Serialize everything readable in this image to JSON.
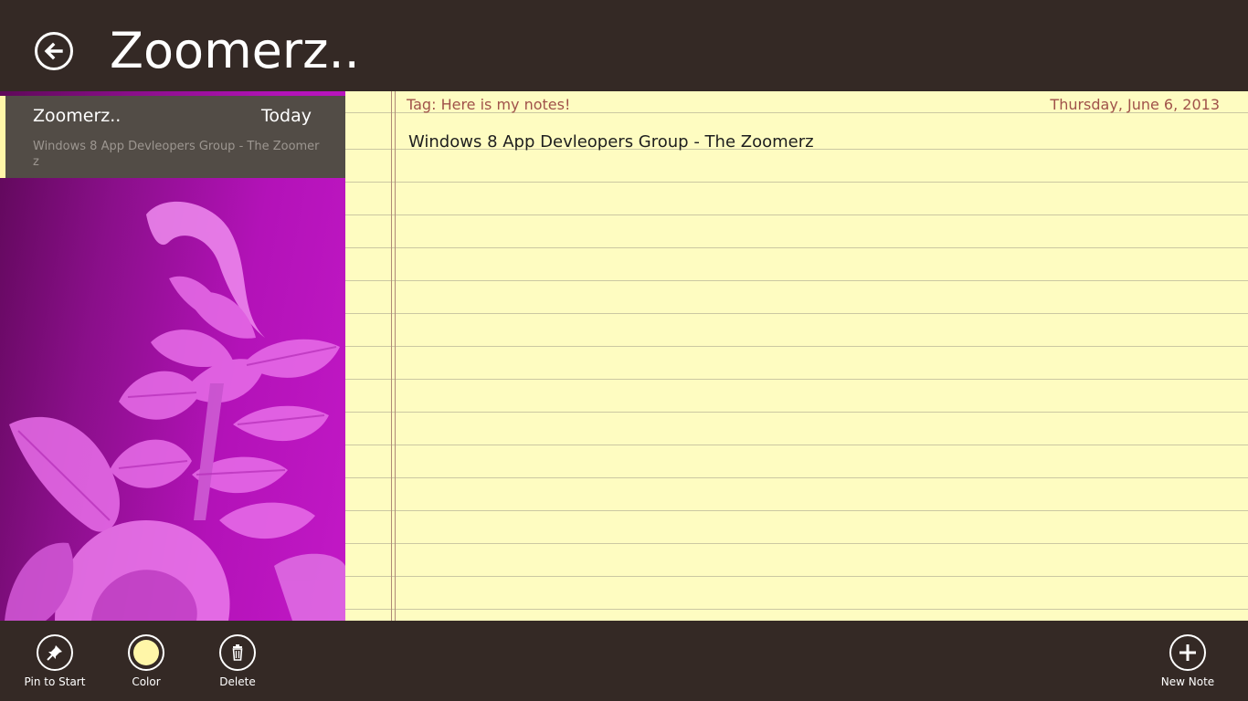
{
  "header": {
    "title": "Zoomerz.."
  },
  "notes_list": {
    "items": [
      {
        "title": "Zoomerz..",
        "date": "Today",
        "preview": "Windows 8 App Devleopers Group - The Zoomerz"
      }
    ]
  },
  "note": {
    "tag": "Tag: Here is my notes!",
    "date": "Thursday, June 6, 2013",
    "body": "Windows 8 App Devleopers Group - The Zoomerz"
  },
  "appbar": {
    "pin_label": "Pin to Start",
    "color_label": "Color",
    "delete_label": "Delete",
    "new_note_label": "New Note"
  },
  "icons": {
    "back": "back-arrow-icon",
    "pin": "pin-icon",
    "color": "color-swatch-icon",
    "delete": "trash-icon",
    "new": "plus-icon"
  },
  "colors": {
    "chrome": "#342925",
    "paper": "#fefcc1",
    "accent_yellow": "#fff6a8",
    "meta_text": "#a0524a",
    "panel_purple": "#b312b8"
  }
}
